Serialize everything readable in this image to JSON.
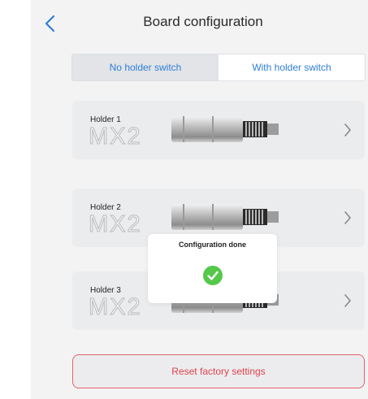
{
  "header": {
    "title": "Board configuration"
  },
  "segment": {
    "options": [
      "No holder switch",
      "With holder switch"
    ],
    "selected": "No holder switch"
  },
  "holders": [
    {
      "label": "Holder 1",
      "model": "MX2"
    },
    {
      "label": "Holder 2",
      "model": "MX2"
    },
    {
      "label": "Holder 3",
      "model": "MX2"
    }
  ],
  "reset": {
    "label": "Reset factory settings"
  },
  "dialog": {
    "title": "Configuration done"
  },
  "colors": {
    "accent": "#2f7fd6",
    "danger": "#e0424c",
    "success": "#55c84a"
  },
  "icons": [
    "chevron-left-icon",
    "chevron-right-icon",
    "motor-image",
    "checkmark-icon"
  ]
}
